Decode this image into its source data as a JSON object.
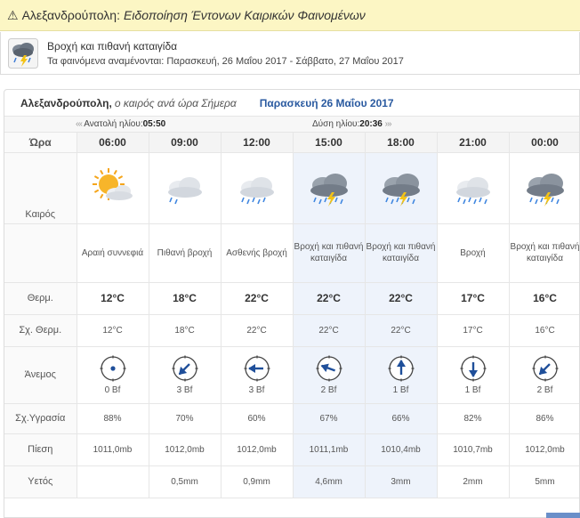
{
  "alert": {
    "city": "Αλεξανδρούπολη:",
    "title": "Ειδοποίηση Έντονων Καιρικών Φαινομένων",
    "event": "Βροχή και πιθανή καταιγίδα",
    "period_label": "Τα φαινόμενα αναμένονται:",
    "period": "Παρασκευή, 26 Μαΐου 2017 - Σάββατο, 27 Μαΐου 2017"
  },
  "forecast": {
    "city": "Αλεξανδρούπολη,",
    "subtitle": "ο καιρός ανά ώρα Σήμερα",
    "date": "Παρασκευή 26 Μαΐου 2017",
    "sunrise_label": "Ανατολή ηλίου:",
    "sunrise": "05:50",
    "sunset_label": "Δύση ηλίου:",
    "sunset": "20:36",
    "labels": {
      "hour": "Ώρα",
      "weather": "Καιρός",
      "temp": "Θερμ.",
      "feel": "Σχ. Θερμ.",
      "wind": "Άνεμος",
      "humidity": "Σχ.Υγρασία",
      "pressure": "Πίεση",
      "rain": "Υετός"
    },
    "hours": [
      {
        "time": "06:00",
        "icon": "partly-cloudy-sun-icon",
        "desc": "Αραιή συννεφιά",
        "temp": "12°C",
        "feel": "12°C",
        "wind_dir": "calm",
        "wind": "0 Bf",
        "humidity": "88%",
        "pressure": "1011,0mb",
        "rain": ""
      },
      {
        "time": "09:00",
        "icon": "light-rain-cloud-icon",
        "desc": "Πιθανή βροχή",
        "temp": "18°C",
        "feel": "18°C",
        "wind_dir": "sw",
        "wind": "3 Bf",
        "humidity": "70%",
        "pressure": "1012,0mb",
        "rain": "0,5mm"
      },
      {
        "time": "12:00",
        "icon": "rain-cloud-icon",
        "desc": "Ασθενής βροχή",
        "temp": "22°C",
        "feel": "22°C",
        "wind_dir": "w",
        "wind": "3 Bf",
        "humidity": "60%",
        "pressure": "1012,0mb",
        "rain": "0,9mm"
      },
      {
        "time": "15:00",
        "icon": "thunderstorm-icon",
        "desc": "Βροχή και πιθανή καταιγίδα",
        "temp": "22°C",
        "feel": "22°C",
        "wind_dir": "wnw",
        "wind": "2 Bf",
        "humidity": "67%",
        "pressure": "1011,1mb",
        "rain": "4,6mm"
      },
      {
        "time": "18:00",
        "icon": "thunderstorm-icon",
        "desc": "Βροχή και πιθανή καταιγίδα",
        "temp": "22°C",
        "feel": "22°C",
        "wind_dir": "n",
        "wind": "1 Bf",
        "humidity": "66%",
        "pressure": "1010,4mb",
        "rain": "3mm"
      },
      {
        "time": "21:00",
        "icon": "heavy-rain-cloud-icon",
        "desc": "Βροχή",
        "temp": "17°C",
        "feel": "17°C",
        "wind_dir": "s",
        "wind": "1 Bf",
        "humidity": "82%",
        "pressure": "1010,7mb",
        "rain": "2mm"
      },
      {
        "time": "00:00",
        "icon": "thunderstorm-icon",
        "desc": "Βροχή και πιθανή καταιγίδα",
        "temp": "16°C",
        "feel": "16°C",
        "wind_dir": "sw",
        "wind": "2 Bf",
        "humidity": "86%",
        "pressure": "1012,0mb",
        "rain": "5mm"
      }
    ]
  },
  "colors": {
    "alert_bg": "#fcf6c4",
    "date_blue": "#2a5aa0",
    "arrow_blue": "#1f4f9a",
    "highlight_col": "#eef3fb"
  }
}
